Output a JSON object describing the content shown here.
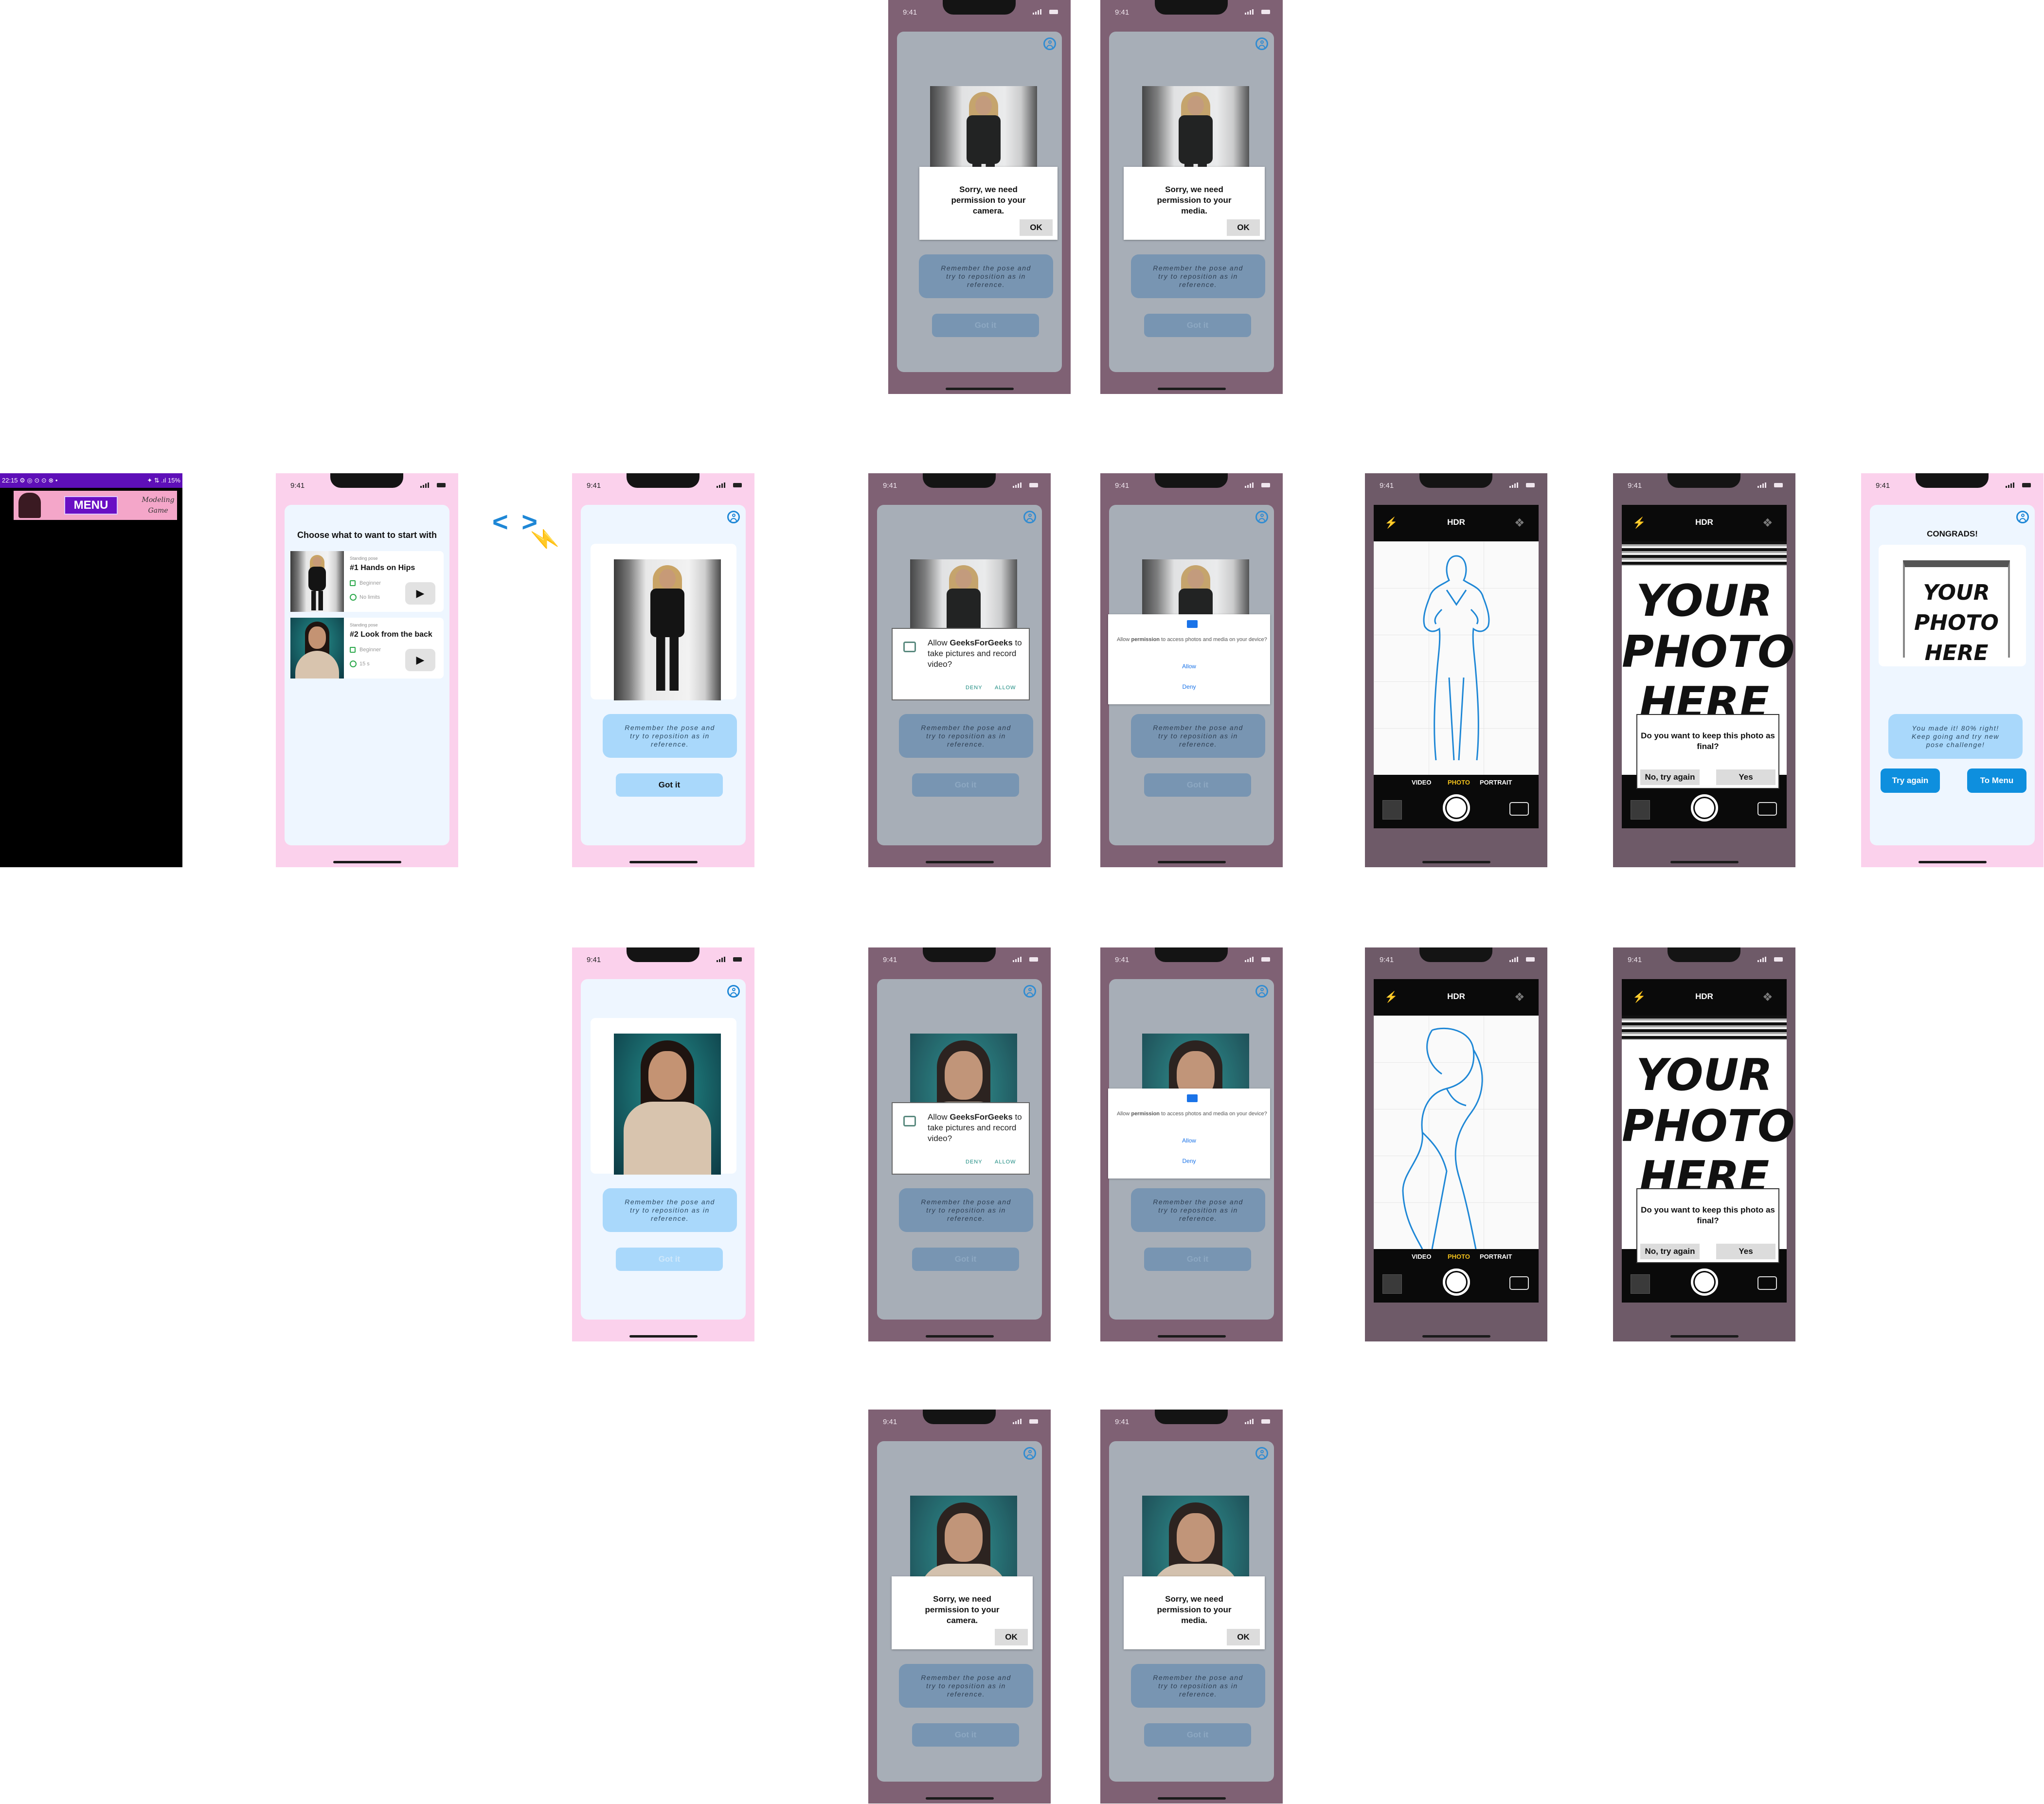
{
  "status_time": "9:41",
  "android_status": "22:15 ⚙ ◎ ⊙ ⊙ ⊗ •",
  "android_right": "✦ ⇅ .ıl 15%",
  "menu_label": "MENU",
  "logo_text": "Modeling Game",
  "arrow_glyphs": "< >",
  "menu_screen": {
    "title": "Choose what to want to start with",
    "cards": [
      {
        "category": "Standing pose",
        "name": "#1 Hands on Hips",
        "level": "Beginner",
        "time": "No limits"
      },
      {
        "category": "Standing pose",
        "name": "#2 Look from the back",
        "level": "Beginner",
        "time": "15 s"
      }
    ]
  },
  "reminder": "Remember the pose and try to reposition as in reference.",
  "got_it": "Got it",
  "camera_denied": "Sorry, we need permission to your camera.",
  "media_denied": "Sorry, we need permission to your media.",
  "ok": "OK",
  "allow_camera": {
    "text_prefix": "Allow ",
    "app": "GeeksForGeeks",
    "text_suffix": " to take pictures and record video?",
    "deny": "DENY",
    "allow": "ALLOW"
  },
  "allow_media": {
    "prefix": "Allow ",
    "bold": "permission",
    "suffix": " to access photos and media on your device?",
    "allow": "Allow",
    "deny": "Deny"
  },
  "camera": {
    "hdr": "HDR",
    "modes": [
      "VIDEO",
      "PHOTO",
      "PORTRAIT"
    ],
    "active_mode": "PHOTO",
    "flash_icon": "⚡",
    "filter_icon": "❖"
  },
  "your_photo": "YOUR PHOTO HERE",
  "keep_dialog": {
    "question": "Do you want to keep this photo as final?",
    "no": "No, try again",
    "yes": "Yes"
  },
  "result": {
    "title": "CONGRADS!",
    "message": "You made it! 80% right! Keep going and try new pose challenge!",
    "try_again": "Try again",
    "to_menu": "To Menu"
  },
  "colors": {
    "accent": "#1e87d6",
    "pink_frame": "#fbd1ec",
    "dim_frame": "#7f6174",
    "pill": "#a9d8fb",
    "android_bar": "#5e0fb8"
  }
}
